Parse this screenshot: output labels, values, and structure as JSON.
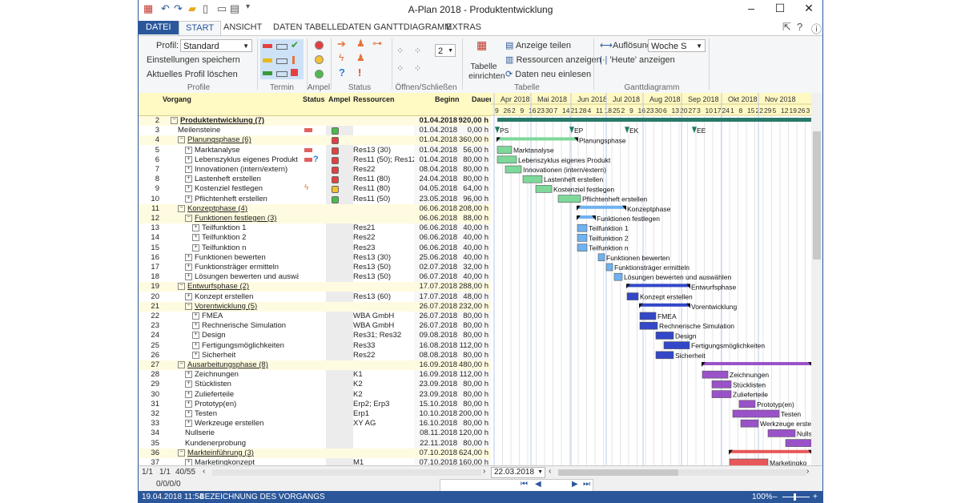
{
  "window": {
    "title": "A-Plan 2018 - Produktentwicklung"
  },
  "tabs": {
    "file": "DATEI",
    "start": "START",
    "view": "ANSICHT",
    "table_data": "DATEN TABELLE",
    "gantt_data": "DATEN GANTTDIAGRAMM",
    "extras": "EXTRAS"
  },
  "ribbon": {
    "profil_label": "Profil:",
    "profil_value": "Standard",
    "save_settings": "Einstellungen speichern",
    "delete_profile": "Aktuelles Profil löschen",
    "grp_profile": "Profile",
    "grp_termin": "Termin",
    "grp_ampel": "Ampel",
    "grp_status": "Status",
    "grp_open": "Öffnen/Schließen",
    "open_level": "2",
    "table_setup": "Tabelle einrichten",
    "show_part": "Anzeige teilen",
    "show_res": "Ressourcen anzeigen",
    "reload": "Daten neu einlesen",
    "grp_table": "Tabelle",
    "resolution_label": "Auflösung:",
    "resolution_value": "Woche S",
    "show_today": "'Heute' anzeigen",
    "grp_gantt": "Ganttdiagramm"
  },
  "columns": {
    "task": "Vorgang",
    "status": "Status",
    "ampel": "Ampel",
    "resources": "Ressourcen",
    "begin": "Beginn",
    "duration": "Dauer"
  },
  "months": [
    "Apr 2018",
    "Mai 2018",
    "Jun 2018",
    "Jul 2018",
    "Aug 2018",
    "Sep 2018",
    "Okt 2018",
    "Nov 2018"
  ],
  "days": [
    "9",
    "26",
    "2",
    "9",
    "16",
    "23",
    "30",
    "7",
    "14",
    "21",
    "28",
    "4",
    "11",
    "18",
    "25",
    "2",
    "9",
    "16",
    "23",
    "30",
    "6",
    "13",
    "20",
    "27",
    "3",
    "10",
    "17",
    "24",
    "1",
    "8",
    "15",
    "22",
    "29",
    "5",
    "12",
    "19",
    "26",
    "3"
  ],
  "rows": [
    {
      "n": "2",
      "name": "Produktentwicklung (7)",
      "res": "",
      "beg": "01.04.2018",
      "dur": "920,00 h"
    },
    {
      "n": "3",
      "name": "Meilensteine",
      "res": "",
      "beg": "01.04.2018",
      "dur": "0,00 h"
    },
    {
      "n": "4",
      "name": "Planungsphase (6)",
      "res": "",
      "beg": "01.04.2018",
      "dur": "360,00 h"
    },
    {
      "n": "5",
      "name": "Marktanalyse",
      "res": "Res13 (30)",
      "beg": "01.04.2018",
      "dur": "56,00 h"
    },
    {
      "n": "6",
      "name": "Lebenszyklus eigenes Produkt",
      "res": "Res11 (50); Res12;",
      "beg": "01.04.2018",
      "dur": "80,00 h"
    },
    {
      "n": "7",
      "name": "Innovationen (intern/extern)",
      "res": "Res22",
      "beg": "08.04.2018",
      "dur": "80,00 h"
    },
    {
      "n": "8",
      "name": "Lastenheft erstellen",
      "res": "Res11 (80)",
      "beg": "24.04.2018",
      "dur": "80,00 h"
    },
    {
      "n": "9",
      "name": "Kostenziel festlegen",
      "res": "Res11 (80)",
      "beg": "04.05.2018",
      "dur": "64,00 h"
    },
    {
      "n": "10",
      "name": "Pflichtenheft erstellen",
      "res": "Res11 (50)",
      "beg": "23.05.2018",
      "dur": "96,00 h"
    },
    {
      "n": "11",
      "name": "Konzeptphase (4)",
      "res": "",
      "beg": "06.06.2018",
      "dur": "208,00 h"
    },
    {
      "n": "12",
      "name": "Funktionen festlegen (3)",
      "res": "",
      "beg": "06.06.2018",
      "dur": "88,00 h"
    },
    {
      "n": "13",
      "name": "Teilfunktion 1",
      "res": "Res21",
      "beg": "06.06.2018",
      "dur": "40,00 h"
    },
    {
      "n": "14",
      "name": "Teilfunktion 2",
      "res": "Res22",
      "beg": "06.06.2018",
      "dur": "40,00 h"
    },
    {
      "n": "15",
      "name": "Teilfunktion n",
      "res": "Res23",
      "beg": "06.06.2018",
      "dur": "40,00 h"
    },
    {
      "n": "16",
      "name": "Funktionen bewerten",
      "res": "Res13 (30)",
      "beg": "25.06.2018",
      "dur": "40,00 h"
    },
    {
      "n": "17",
      "name": "Funktionsträger ermitteln",
      "res": "Res13 (50)",
      "beg": "02.07.2018",
      "dur": "32,00 h"
    },
    {
      "n": "18",
      "name": "Lösungen bewerten und auswäh",
      "res": "Res13 (50)",
      "beg": "06.07.2018",
      "dur": "40,00 h"
    },
    {
      "n": "19",
      "name": "Entwurfsphase (2)",
      "res": "",
      "beg": "17.07.2018",
      "dur": "288,00 h"
    },
    {
      "n": "20",
      "name": "Konzept erstellen",
      "res": "Res13 (60)",
      "beg": "17.07.2018",
      "dur": "48,00 h"
    },
    {
      "n": "21",
      "name": "Vorentwicklung (5)",
      "res": "",
      "beg": "26.07.2018",
      "dur": "232,00 h"
    },
    {
      "n": "22",
      "name": "FMEA",
      "res": "WBA GmbH",
      "beg": "26.07.2018",
      "dur": "80,00 h"
    },
    {
      "n": "23",
      "name": "Rechnerische Simulation",
      "res": "WBA GmbH",
      "beg": "26.07.2018",
      "dur": "80,00 h"
    },
    {
      "n": "24",
      "name": "Design",
      "res": "Res31; Res32",
      "beg": "09.08.2018",
      "dur": "80,00 h"
    },
    {
      "n": "25",
      "name": "Fertigungsmöglichkeiten",
      "res": "Res33",
      "beg": "16.08.2018",
      "dur": "112,00 h"
    },
    {
      "n": "26",
      "name": "Sicherheit",
      "res": "Res22",
      "beg": "08.08.2018",
      "dur": "80,00 h"
    },
    {
      "n": "27",
      "name": "Ausarbeitungsphase (8)",
      "res": "",
      "beg": "16.09.2018",
      "dur": "480,00 h"
    },
    {
      "n": "28",
      "name": "Zeichnungen",
      "res": "K1",
      "beg": "16.09.2018",
      "dur": "112,00 h"
    },
    {
      "n": "29",
      "name": "Stücklisten",
      "res": "K2",
      "beg": "23.09.2018",
      "dur": "80,00 h"
    },
    {
      "n": "30",
      "name": "Zulieferteile",
      "res": "K2",
      "beg": "23.09.2018",
      "dur": "80,00 h"
    },
    {
      "n": "31",
      "name": "Prototyp(en)",
      "res": "Erp2; Erp3",
      "beg": "15.10.2018",
      "dur": "80,00 h"
    },
    {
      "n": "32",
      "name": "Testen",
      "res": "Erp1",
      "beg": "10.10.2018",
      "dur": "200,00 h"
    },
    {
      "n": "33",
      "name": "Werkzeuge erstellen",
      "res": "XY AG",
      "beg": "16.10.2018",
      "dur": "80,00 h"
    },
    {
      "n": "34",
      "name": "Nullserie",
      "res": "",
      "beg": "08.11.2018",
      "dur": "120,00 h"
    },
    {
      "n": "35",
      "name": "Kundenerprobung",
      "res": "",
      "beg": "22.11.2018",
      "dur": "80,00 h"
    },
    {
      "n": "36",
      "name": "Markteinführung (3)",
      "res": "",
      "beg": "07.10.2018",
      "dur": "624,00 h"
    },
    {
      "n": "37",
      "name": "Marketingkonzept",
      "res": "M1",
      "beg": "07.10.2018",
      "dur": "160,00 h"
    }
  ],
  "milestones": [
    "PS",
    "EP",
    "EK",
    "EE"
  ],
  "bar_labels": {
    "4": "Planungsphase",
    "5": "Marktanalyse",
    "6": "Lebenszyklus eigenes Produkt",
    "7": "Innovationen (intern/extern)",
    "8": "Lastenheft erstellen",
    "9": "Kostenziel festlegen",
    "10": "Pflichtenheft erstellen",
    "11": "Konzeptphase",
    "12": "Funktionen festlegen",
    "13": "Teilfunktion 1",
    "14": "Teilfunktion 2",
    "15": "Teilfunktion n",
    "16": "Funktionen bewerten",
    "17": "Funktionsträger ermitteln",
    "18": "Lösungen bewerten und auswählen",
    "19": "Entwurfsphase",
    "20": "Konzept erstellen",
    "21": "Vorentwicklung",
    "22": "FMEA",
    "23": "Rechnerische Simulation",
    "24": "Design",
    "25": "Fertigungsmöglichkeiten",
    "26": "Sicherheit",
    "28": "Zeichnungen",
    "29": "Stücklisten",
    "30": "Zulieferteile",
    "31": "Prototyp(en)",
    "32": "Testen",
    "33": "Werkzeuge erstellen",
    "34": "Nullserie",
    "37": "Marketingko"
  },
  "footer": {
    "pos1": "1/1",
    "pos2": "1/1",
    "pos3": "40/55",
    "zeros": "0/0/0/0",
    "date": "22.03.2018"
  },
  "statusbar": {
    "datetime": "19.04.2018  11:54",
    "field": "BEZEICHNUNG DES VORGANGS",
    "zoom": "100%"
  },
  "colors": {
    "accent": "#2b579a",
    "green_bar": "#7dd89a",
    "blue_light": "#6fb2f0",
    "blue_dark": "#3347c8",
    "purple": "#9a52c8",
    "red": "#e8585a"
  }
}
